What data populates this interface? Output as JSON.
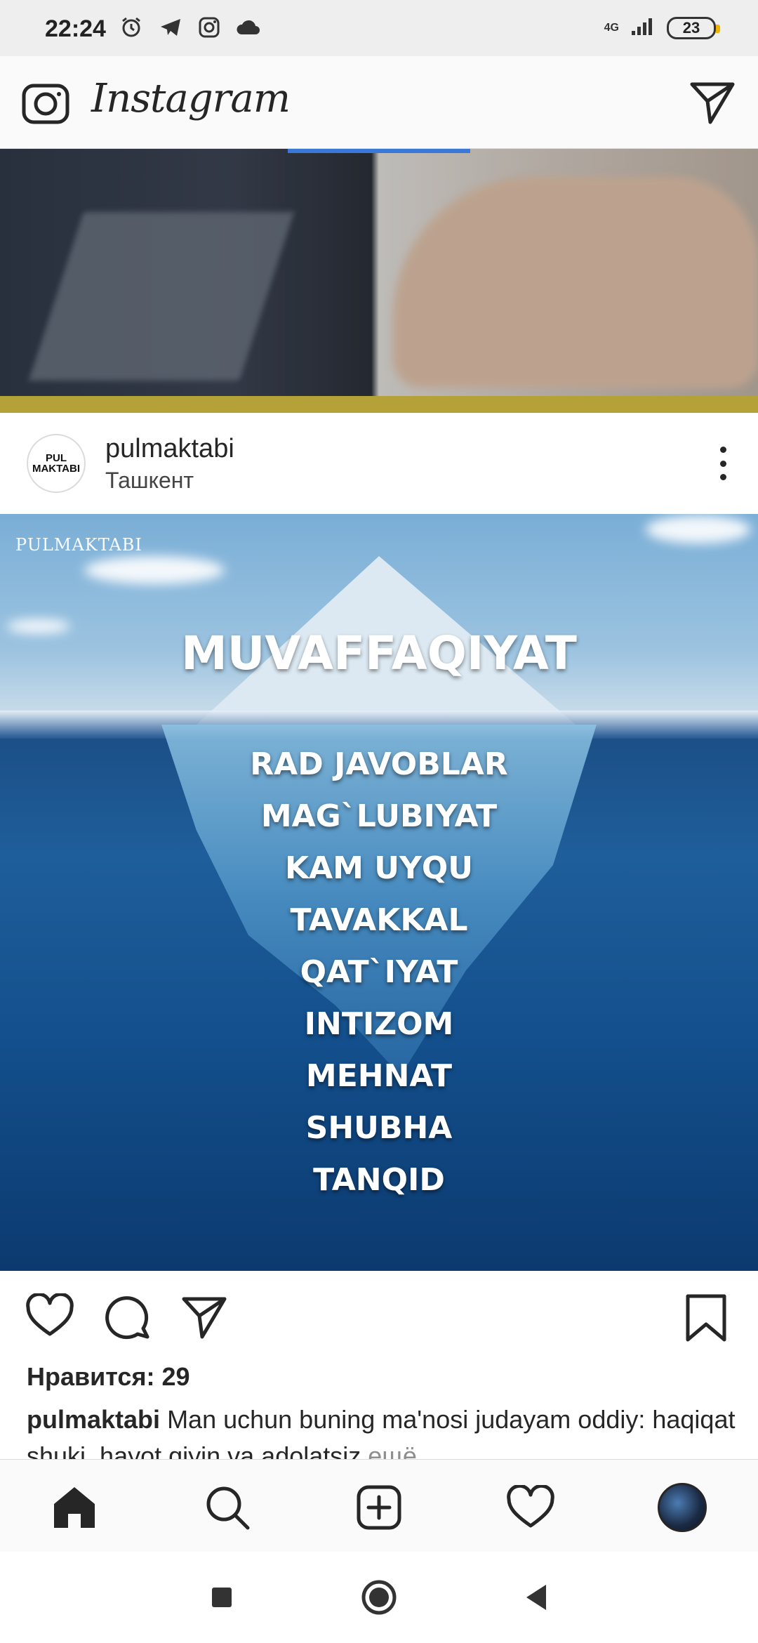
{
  "status_bar": {
    "time": "22:24",
    "network": "4G",
    "battery": "23",
    "icons": [
      "alarm-icon",
      "telegram-icon",
      "instagram-icon",
      "cloud-icon",
      "signal-icon",
      "battery-icon"
    ]
  },
  "app_bar": {
    "logo": "Instagram",
    "icons": [
      "camera-icon",
      "direct-message-icon"
    ]
  },
  "post": {
    "username": "pulmaktabi",
    "location": "Ташкент",
    "avatar_text": [
      "PUL",
      "MAKTABI"
    ],
    "image": {
      "watermark": "PULMAKTABI",
      "headline": "MUVAFFAQIYAT",
      "words": [
        "RAD JAVOBLAR",
        "MAG`LUBIYAT",
        "KAM UYQU",
        "TAVAKKAL",
        "QAT`IYAT",
        "INTIZOM",
        "MEHNAT",
        "SHUBHA",
        "TANQID"
      ]
    },
    "likes": "Нравится: 29",
    "caption_user": "pulmaktabi",
    "caption_text": "Man uchun buning ma'nosi judayam oddiy: haqiqat shuki, hayot qiyin va adolatsiz",
    "more_label": "ещё"
  },
  "bottom_nav": [
    "home-icon",
    "search-icon",
    "new-post-icon",
    "activity-heart-icon",
    "profile-avatar"
  ],
  "system_nav": [
    "recents-icon",
    "home-circle-icon",
    "back-icon"
  ],
  "colors": {
    "text": "#262626",
    "secondary": "#8e8e8e",
    "bar": "#fafafa"
  }
}
